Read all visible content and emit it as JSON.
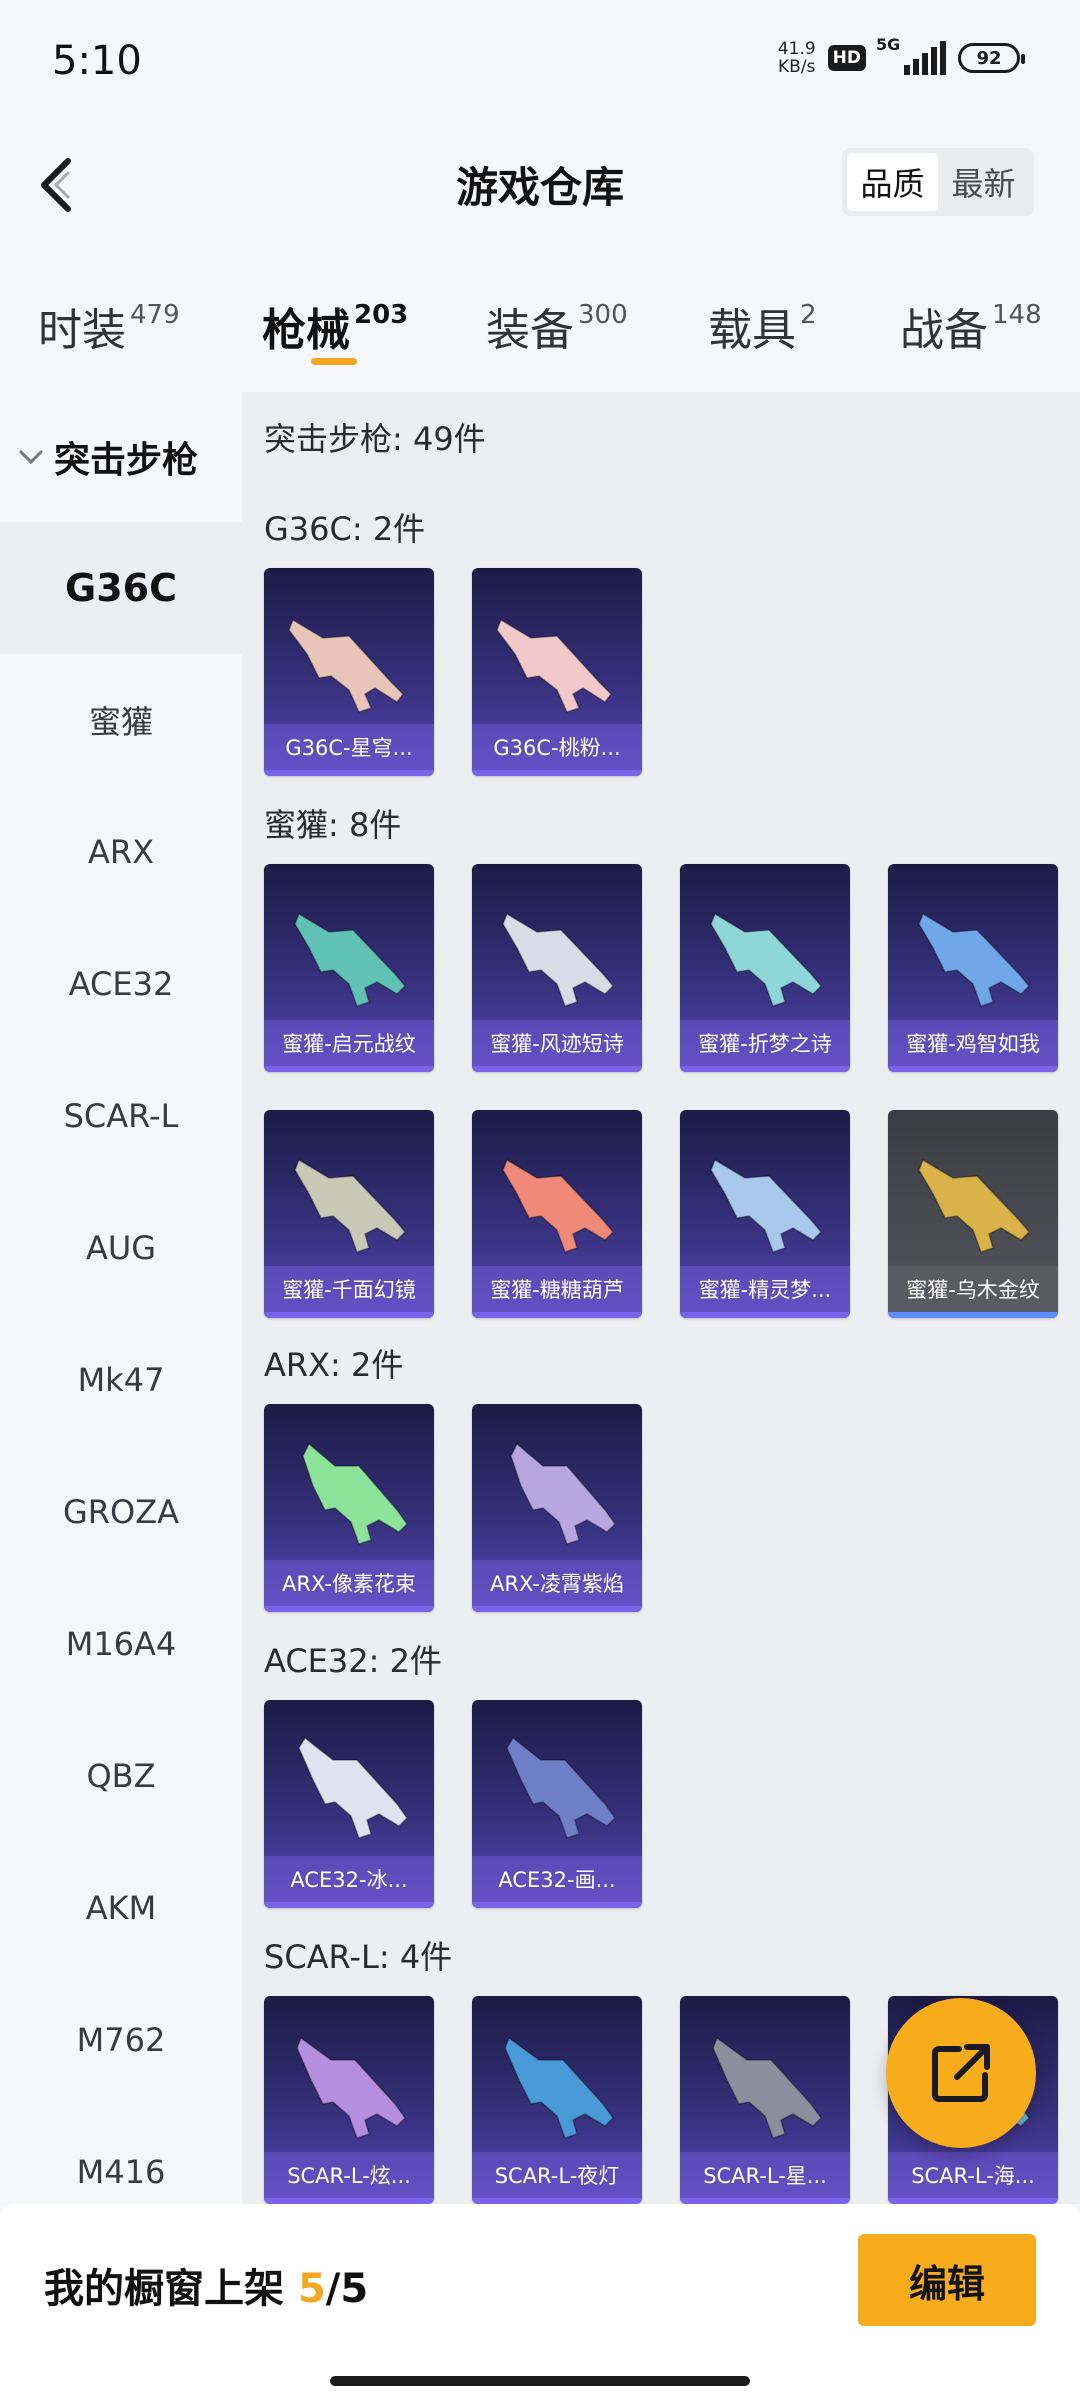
{
  "status_bar": {
    "time": "5:10",
    "net_speed_value": "41.9",
    "net_speed_unit": "KB/s",
    "hd": "HD",
    "network": "5G",
    "battery": "92"
  },
  "header": {
    "title": "游戏仓库",
    "sort_options": [
      "品质",
      "最新"
    ],
    "active_sort": "品质"
  },
  "tabs": [
    {
      "label": "时装",
      "count": "479"
    },
    {
      "label": "枪械",
      "count": "203"
    },
    {
      "label": "装备",
      "count": "300"
    },
    {
      "label": "载具",
      "count": "2"
    },
    {
      "label": "战备",
      "count": "148"
    }
  ],
  "active_tab": "枪械",
  "sidebar": {
    "category": "突击步枪",
    "items": [
      "G36C",
      "蜜獾",
      "ARX",
      "ACE32",
      "SCAR-L",
      "AUG",
      "Mk47",
      "GROZA",
      "M16A4",
      "QBZ",
      "AKM",
      "M762",
      "M416"
    ],
    "active": "G36C"
  },
  "main": {
    "summary": "突击步枪: 49件",
    "groups": [
      {
        "title": "G36C: 2件",
        "items": [
          {
            "name": "G36C-星穹...",
            "color": "#e9c4b8"
          },
          {
            "name": "G36C-桃粉...",
            "color": "#f2c9c9"
          }
        ]
      },
      {
        "title": "蜜獾: 8件",
        "items": [
          {
            "name": "蜜獾-启元战纹",
            "color": "#5fc2b4"
          },
          {
            "name": "蜜獾-风迹短诗",
            "color": "#d9dbe6"
          },
          {
            "name": "蜜獾-折梦之诗",
            "color": "#8fd6d8"
          },
          {
            "name": "蜜獾-鸡智如我",
            "color": "#6fa7e8"
          },
          {
            "name": "蜜獾-千面幻镜",
            "color": "#c9c9b8"
          },
          {
            "name": "蜜獾-糖糖葫芦",
            "color": "#ef8a78"
          },
          {
            "name": "蜜獾-精灵梦...",
            "color": "#a8c8ec"
          },
          {
            "name": "蜜獾-乌木金纹",
            "color": "#d9b24a",
            "gray": true
          }
        ]
      },
      {
        "title": "ARX: 2件",
        "items": [
          {
            "name": "ARX-像素花束",
            "color": "#8ce39a"
          },
          {
            "name": "ARX-凌霄紫焰",
            "color": "#b7a6e0"
          }
        ]
      },
      {
        "title": "ACE32: 2件",
        "items": [
          {
            "name": "ACE32-冰...",
            "color": "#dfe2ef"
          },
          {
            "name": "ACE32-画...",
            "color": "#6e7fc8"
          }
        ]
      },
      {
        "title": "SCAR-L: 4件",
        "items": [
          {
            "name": "SCAR-L-炫...",
            "color": "#b58ee0"
          },
          {
            "name": "SCAR-L-夜灯",
            "color": "#4a9ad8"
          },
          {
            "name": "SCAR-L-星...",
            "color": "#8b8e9c"
          },
          {
            "name": "SCAR-L-海...",
            "color": "#6fb8d8"
          }
        ]
      }
    ]
  },
  "bottom_bar": {
    "label": "我的橱窗上架",
    "current": "5",
    "total": "/5",
    "edit_label": "编辑"
  },
  "icons": {
    "back": "chevron-left-icon",
    "share": "share-external-icon",
    "collapse": "chevron-down-icon"
  }
}
